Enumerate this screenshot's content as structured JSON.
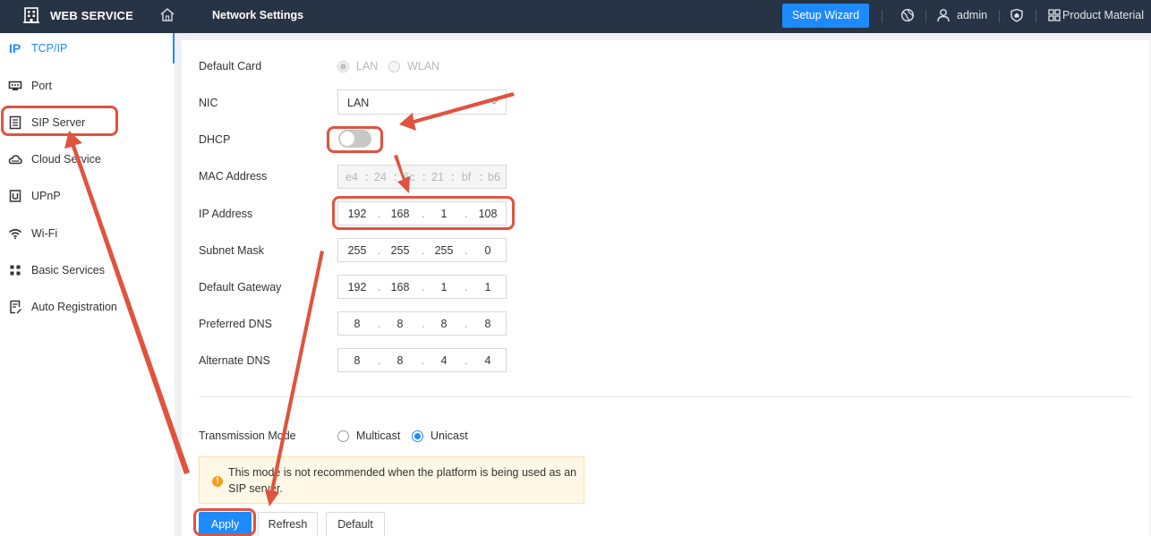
{
  "header": {
    "brand": "WEB SERVICE",
    "page_title": "Network Settings",
    "setup_wizard": "Setup Wizard",
    "user": "admin",
    "product_material": "Product Material"
  },
  "sidebar": {
    "items": [
      {
        "label": "TCP/IP",
        "icon": "ip-icon",
        "active": true
      },
      {
        "label": "Port",
        "icon": "port-icon"
      },
      {
        "label": "SIP Server",
        "icon": "sip-server-icon"
      },
      {
        "label": "Cloud Service",
        "icon": "cloud-icon"
      },
      {
        "label": "UPnP",
        "icon": "upnp-icon"
      },
      {
        "label": "Wi-Fi",
        "icon": "wifi-icon"
      },
      {
        "label": "Basic Services",
        "icon": "grid-icon"
      },
      {
        "label": "Auto Registration",
        "icon": "registration-icon"
      }
    ],
    "ip_glyph": "IP"
  },
  "form": {
    "default_card": {
      "label": "Default Card",
      "options": [
        "LAN",
        "WLAN"
      ],
      "selected": "LAN"
    },
    "nic": {
      "label": "NIC",
      "value": "LAN"
    },
    "dhcp": {
      "label": "DHCP",
      "enabled": false
    },
    "mac": {
      "label": "MAC Address",
      "octets": [
        "e4",
        "24",
        "6c",
        "21",
        "bf",
        "b6"
      ]
    },
    "ip": {
      "label": "IP Address",
      "octets": [
        "192",
        "168",
        "1",
        "108"
      ]
    },
    "subnet": {
      "label": "Subnet Mask",
      "octets": [
        "255",
        "255",
        "255",
        "0"
      ]
    },
    "gateway": {
      "label": "Default Gateway",
      "octets": [
        "192",
        "168",
        "1",
        "1"
      ]
    },
    "dns1": {
      "label": "Preferred DNS",
      "octets": [
        "8",
        "8",
        "8",
        "8"
      ]
    },
    "dns2": {
      "label": "Alternate DNS",
      "octets": [
        "8",
        "8",
        "4",
        "4"
      ]
    },
    "transmission": {
      "label": "Transmission Mode",
      "options": [
        "Multicast",
        "Unicast"
      ],
      "selected": "Unicast"
    },
    "notice": "This mode is not recommended when the platform is being used as an SIP server.",
    "notice_icon": "!",
    "separator": "."
  },
  "buttons": {
    "apply": "Apply",
    "refresh": "Refresh",
    "default": "Default"
  },
  "colors": {
    "accent": "#1e8aff",
    "topbar": "#273445",
    "annotation": "#e0533f",
    "notice_bg": "#fff8e6",
    "notice_icon": "#fa9d1c"
  }
}
